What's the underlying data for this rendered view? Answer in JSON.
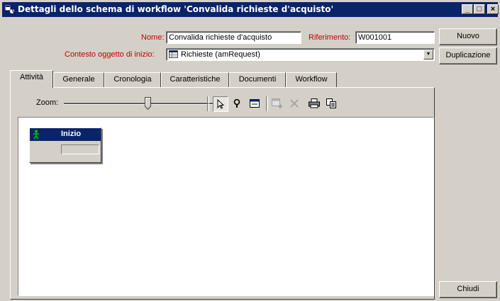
{
  "window": {
    "title": "Dettagli dello schema di workflow 'Convalida richieste d'acquisto'",
    "controls": {
      "minimize": "_",
      "maximize": "□",
      "close": "×"
    }
  },
  "form": {
    "name_label": "Nome:",
    "name_value": "Convalida richieste d'acquisto",
    "ref_label": "Riferimento:",
    "ref_value": "W001001",
    "context_label": "Contesto oggetto di inizio:",
    "context_value": "Richieste (amRequest)"
  },
  "buttons": {
    "new": "Nuovo",
    "duplicate": "Duplicazione",
    "close": "Chiudi"
  },
  "tabs": [
    {
      "label": "Attività",
      "active": true
    },
    {
      "label": "Generale"
    },
    {
      "label": "Cronologia"
    },
    {
      "label": "Caratteristiche"
    },
    {
      "label": "Documenti"
    },
    {
      "label": "Workflow"
    }
  ],
  "toolbar": {
    "zoom_label": "Zoom:",
    "tools": [
      "pointer-icon",
      "magnifier-icon",
      "window-icon",
      "add-activity-icon",
      "delete-icon",
      "print-icon",
      "copy-icon"
    ]
  },
  "canvas": {
    "node": {
      "title": "Inizio",
      "icon": "start-person-icon",
      "color": "#0a246a"
    }
  }
}
